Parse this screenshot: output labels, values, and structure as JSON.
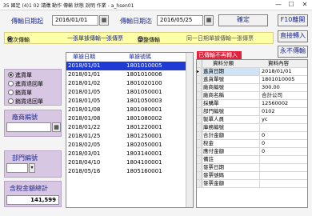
{
  "window": {
    "title": "35 國定 (4)1 02 請購 動作 傳輸 狀態 說明 作業 - a_hsen01",
    "minimize": "—",
    "maximize": "☐",
    "close": "✕"
  },
  "header": {
    "date_start_label": "傳輸日期起",
    "date_start_value": "2016/01/01",
    "date_end_label": "傳輸日期迄",
    "date_end_value": "2016/05/25",
    "confirm_label": "確定",
    "help_label": "F10離開",
    "direct_import_label": "直接轉入",
    "vendor_import_label": "永不傳輸"
  },
  "mode_bar": {
    "opt1": "批次傳輸",
    "opt2": "一張單據傳輸一張傳票",
    "opt3": "彙整傳輸",
    "opt4": "同一日期單據傳輸一張傳票"
  },
  "left_panel": {
    "radios": [
      "進貨單",
      "進貨退回單",
      "銷貨單",
      "銷貨退回單"
    ],
    "selected_radio": 0,
    "vendor_label": "廠商編號",
    "vendor_value": "",
    "dept_label": "部門編號",
    "dept_value": "",
    "total_label": "含稅金額總計",
    "total_value": "141,599"
  },
  "list": {
    "col_date": "單據日期",
    "col_no": "單據號碼",
    "rows": [
      {
        "date": "2018/01/01",
        "no": "1801010005"
      },
      {
        "date": "2018/01/01",
        "no": "1801010006"
      },
      {
        "date": "2018/01/02",
        "no": "1801020100"
      },
      {
        "date": "2018/01/05",
        "no": "1801050001"
      },
      {
        "date": "2018/01/05",
        "no": "1801050003"
      },
      {
        "date": "2018/01/08",
        "no": "1801080001"
      },
      {
        "date": "2018/01/08",
        "no": "1801080002"
      },
      {
        "date": "2018/01/22",
        "no": "1801220001"
      },
      {
        "date": "2018/01/25",
        "no": "1801250001"
      },
      {
        "date": "2018/02/05",
        "no": "1802050001"
      },
      {
        "date": "2018/03/01",
        "no": "1803140001"
      },
      {
        "date": "2018/04/10",
        "no": "1804100001"
      },
      {
        "date": "2018/05/16",
        "no": "1805160001"
      }
    ]
  },
  "detail": {
    "badge": "已傳輸不再轉入",
    "col_field": "資料分類",
    "col_content": "資料內容",
    "rows": [
      {
        "field": "進貨日期",
        "value": "2018/01/01"
      },
      {
        "field": "進貨單號",
        "value": "1801010005"
      },
      {
        "field": "廠商編號",
        "value": "300.00"
      },
      {
        "field": "廠商名稱",
        "value": "合計公司"
      },
      {
        "field": "採購單",
        "value": "12560002"
      },
      {
        "field": "部門編號",
        "value": "0102"
      },
      {
        "field": "製單人員",
        "value": "yc"
      },
      {
        "field": "庫務編號",
        "value": ""
      },
      {
        "field": "合計金額",
        "value": "0"
      },
      {
        "field": "稅金",
        "value": "0"
      },
      {
        "field": "應付金額",
        "value": "0"
      },
      {
        "field": "備註",
        "value": ""
      },
      {
        "field": "發票日期",
        "value": ""
      },
      {
        "field": "發票號碼",
        "value": ""
      },
      {
        "field": "發票金額",
        "value": ""
      }
    ]
  }
}
